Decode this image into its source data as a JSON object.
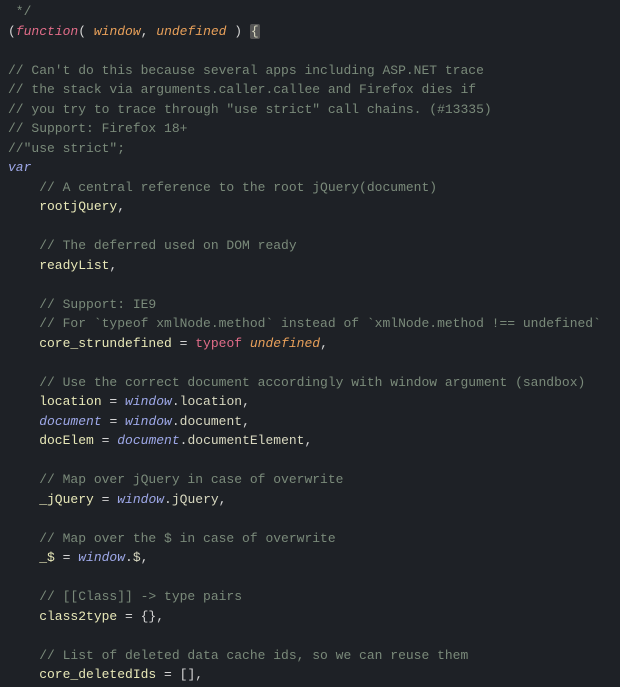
{
  "lines": {
    "l0": " */",
    "l1a": "(",
    "l1b": "function",
    "l1c": "( ",
    "l1d": "window",
    "l1e": ", ",
    "l1f": "undefined",
    "l1g": " ) ",
    "l1h": "{",
    "l2": "",
    "l3": "// Can't do this because several apps including ASP.NET trace",
    "l4": "// the stack via arguments.caller.callee and Firefox dies if",
    "l5": "// you try to trace through \"use strict\" call chains. (#13335)",
    "l6": "// Support: Firefox 18+",
    "l7": "//\"use strict\";",
    "l8": "var",
    "l9": "    // A central reference to the root jQuery(document)",
    "l10a": "    rootjQuery",
    "l10b": ",",
    "l11": "",
    "l12": "    // The deferred used on DOM ready",
    "l13a": "    readyList",
    "l13b": ",",
    "l14": "",
    "l15": "    // Support: IE9",
    "l16": "    // For `typeof xmlNode.method` instead of `xmlNode.method !== undefined`",
    "l17a": "    core_strundefined",
    "l17b": " = ",
    "l17c": "typeof",
    "l17d": " ",
    "l17e": "undefined",
    "l17f": ",",
    "l18": "",
    "l19": "    // Use the correct document accordingly with window argument (sandbox)",
    "l20a": "    location",
    "l20b": " = ",
    "l20c": "window",
    "l20d": ".",
    "l20e": "location",
    "l20f": ",",
    "l21a": "    ",
    "l21b": "document",
    "l21c": " = ",
    "l21d": "window",
    "l21e": ".",
    "l21f": "document",
    "l21g": ",",
    "l22a": "    docElem",
    "l22b": " = ",
    "l22c": "document",
    "l22d": ".",
    "l22e": "documentElement",
    "l22f": ",",
    "l23": "",
    "l24": "    // Map over jQuery in case of overwrite",
    "l25a": "    _jQuery",
    "l25b": " = ",
    "l25c": "window",
    "l25d": ".",
    "l25e": "jQuery",
    "l25f": ",",
    "l26": "",
    "l27": "    // Map over the $ in case of overwrite",
    "l28a": "    _$",
    "l28b": " = ",
    "l28c": "window",
    "l28d": ".",
    "l28e": "$",
    "l28f": ",",
    "l29": "",
    "l30": "    // [[Class]] -> type pairs",
    "l31a": "    class2type",
    "l31b": " = {},",
    "l32": "",
    "l33": "    // List of deleted data cache ids, so we can reuse them",
    "l34a": "    core_deletedIds",
    "l34b": " = [],"
  }
}
